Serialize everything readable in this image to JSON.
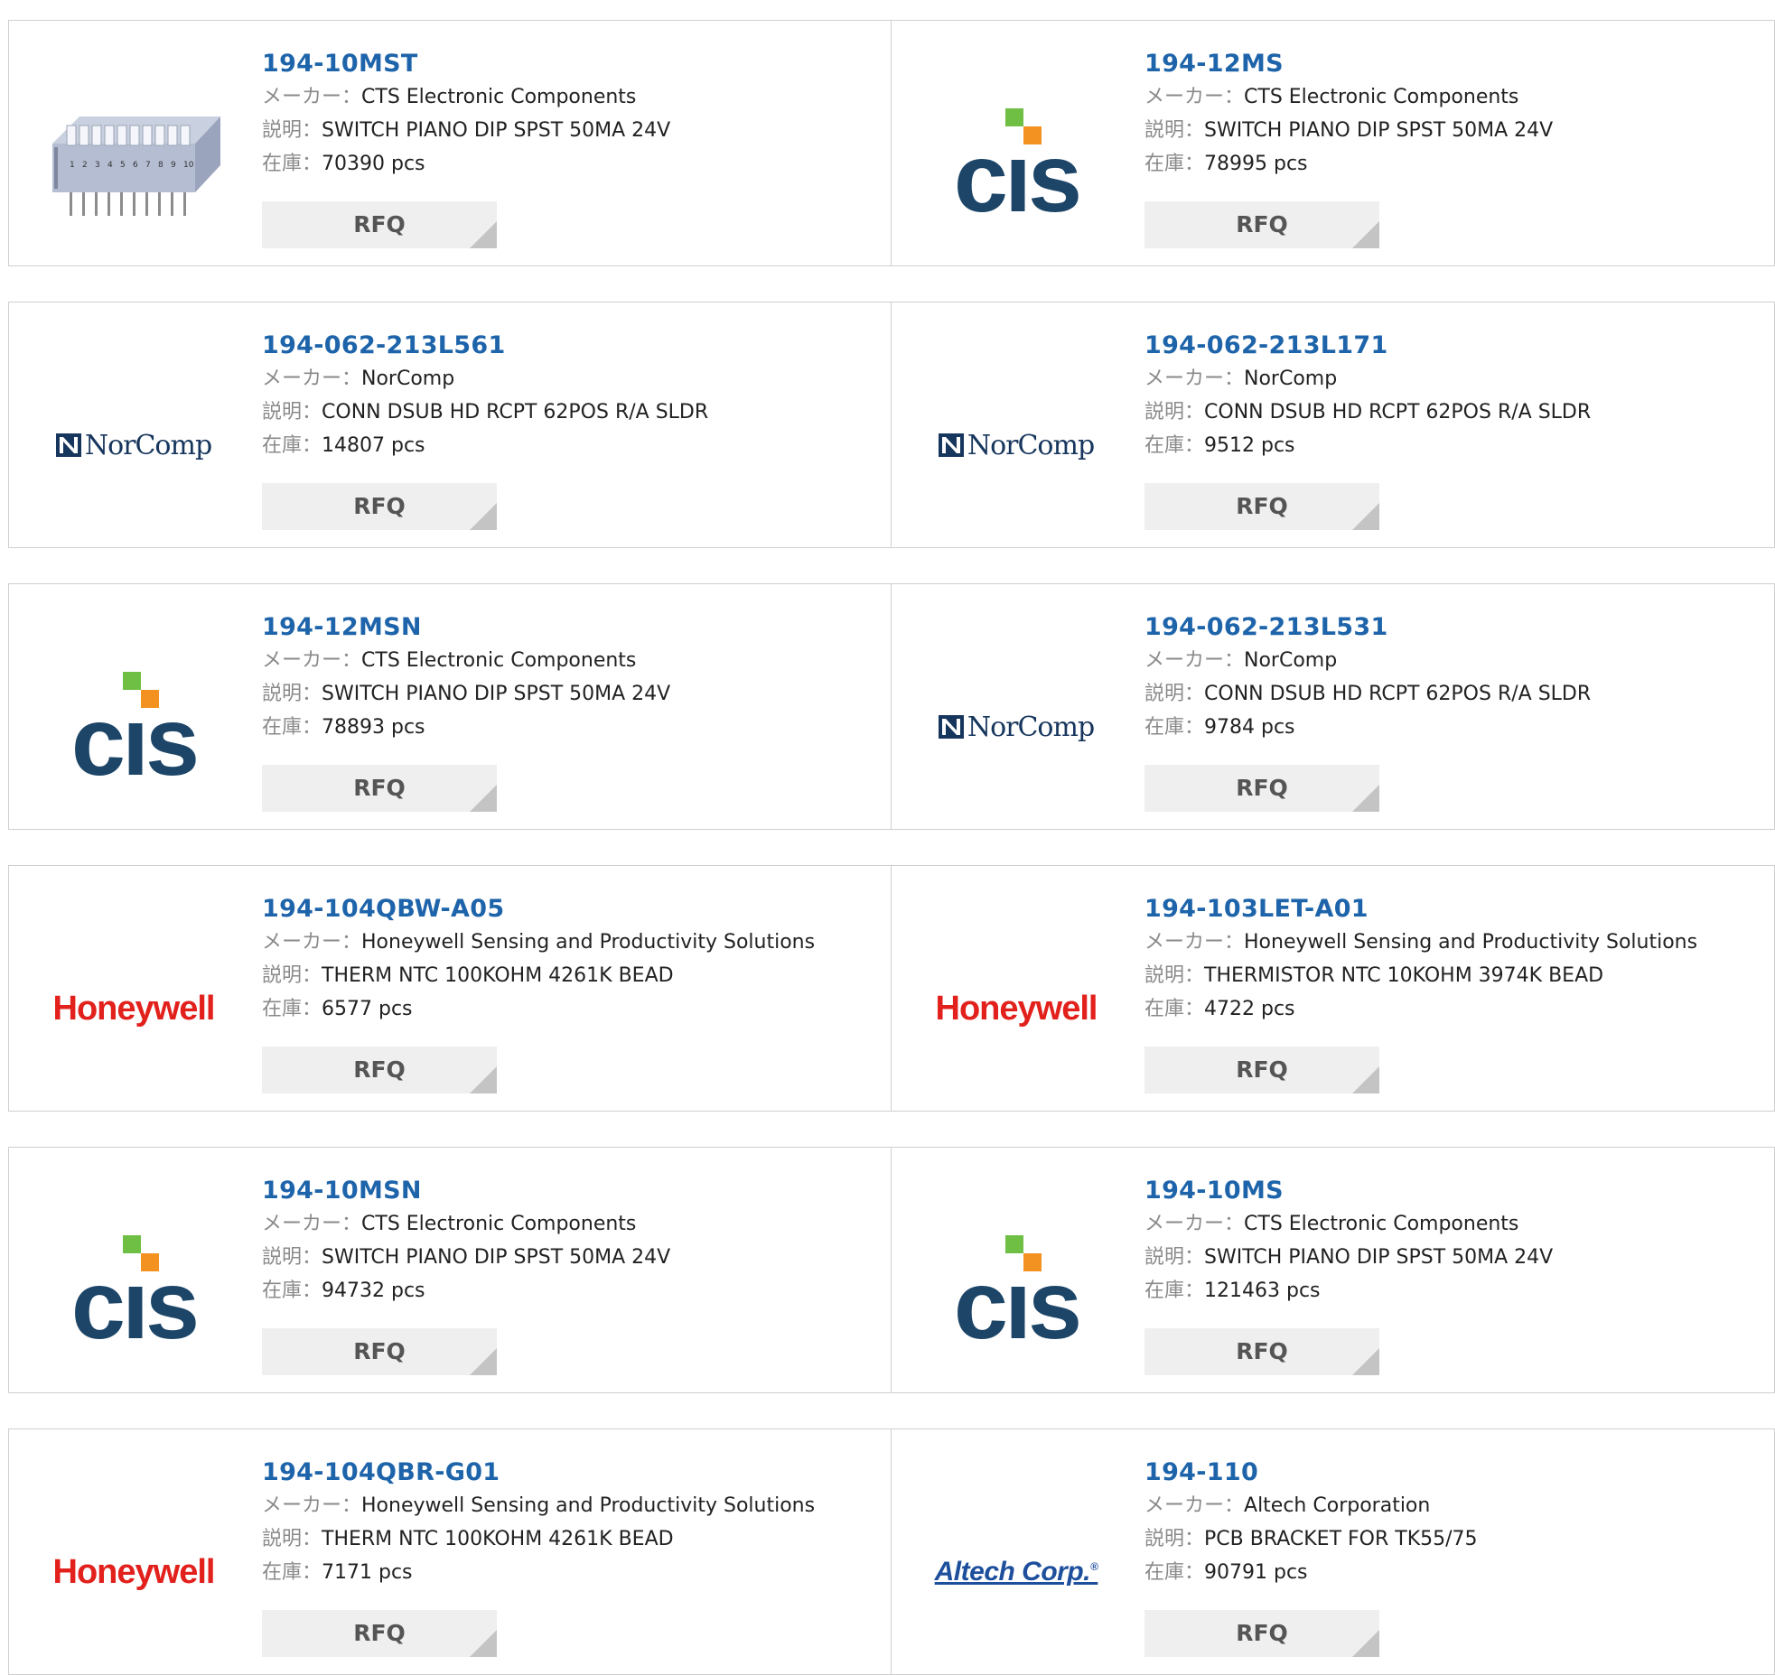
{
  "labels": {
    "manufacturer": "メーカー：",
    "description": "説明：",
    "stock": "在庫："
  },
  "brands": {
    "norcomp": "NorComp",
    "honeywell": "Honeywell",
    "altech": "Altech Corp.",
    "altech_mark": "®"
  },
  "products": [
    {
      "part": "194-10MST",
      "logo": "dip-switch-photo",
      "manufacturer": "CTS Electronic Components",
      "description": "SWITCH PIANO DIP SPST 50MA 24V",
      "stock": "70390 pcs",
      "rfq": "RFQ"
    },
    {
      "part": "194-12MS",
      "logo": "cts-logo",
      "manufacturer": "CTS Electronic Components",
      "description": "SWITCH PIANO DIP SPST 50MA 24V",
      "stock": "78995 pcs",
      "rfq": "RFQ"
    },
    {
      "part": "194-062-213L561",
      "logo": "norcomp-logo",
      "manufacturer": "NorComp",
      "description": "CONN DSUB HD RCPT 62POS R/A SLDR",
      "stock": "14807 pcs",
      "rfq": "RFQ"
    },
    {
      "part": "194-062-213L171",
      "logo": "norcomp-logo",
      "manufacturer": "NorComp",
      "description": "CONN DSUB HD RCPT 62POS R/A SLDR",
      "stock": "9512 pcs",
      "rfq": "RFQ"
    },
    {
      "part": "194-12MSN",
      "logo": "cts-logo",
      "manufacturer": "CTS Electronic Components",
      "description": "SWITCH PIANO DIP SPST 50MA 24V",
      "stock": "78893 pcs",
      "rfq": "RFQ"
    },
    {
      "part": "194-062-213L531",
      "logo": "norcomp-logo",
      "manufacturer": "NorComp",
      "description": "CONN DSUB HD RCPT 62POS R/A SLDR",
      "stock": "9784 pcs",
      "rfq": "RFQ"
    },
    {
      "part": "194-104QBW-A05",
      "logo": "honeywell-logo",
      "manufacturer": "Honeywell Sensing and Productivity Solutions",
      "description": "THERM NTC 100KOHM 4261K BEAD",
      "stock": "6577 pcs",
      "rfq": "RFQ"
    },
    {
      "part": "194-103LET-A01",
      "logo": "honeywell-logo",
      "manufacturer": "Honeywell Sensing and Productivity Solutions",
      "description": "THERMISTOR NTC 10KOHM 3974K BEAD",
      "stock": "4722 pcs",
      "rfq": "RFQ"
    },
    {
      "part": "194-10MSN",
      "logo": "cts-logo",
      "manufacturer": "CTS Electronic Components",
      "description": "SWITCH PIANO DIP SPST 50MA 24V",
      "stock": "94732 pcs",
      "rfq": "RFQ"
    },
    {
      "part": "194-10MS",
      "logo": "cts-logo",
      "manufacturer": "CTS Electronic Components",
      "description": "SWITCH PIANO DIP SPST 50MA 24V",
      "stock": "121463 pcs",
      "rfq": "RFQ"
    },
    {
      "part": "194-104QBR-G01",
      "logo": "honeywell-logo",
      "manufacturer": "Honeywell Sensing and Productivity Solutions",
      "description": "THERM NTC 100KOHM 4261K BEAD",
      "stock": "7171 pcs",
      "rfq": "RFQ"
    },
    {
      "part": "194-110",
      "logo": "altech-logo",
      "manufacturer": "Altech Corporation",
      "description": "PCB BRACKET FOR TK55/75",
      "stock": "90791 pcs",
      "rfq": "RFQ"
    }
  ],
  "colors": {
    "part_link": "#1e64aa",
    "label": "#8a8a8a",
    "cts_blue": "#1c4568",
    "cts_green": "#6fbf44",
    "cts_orange": "#f39221",
    "honeywell_red": "#e2211c",
    "norcomp_navy": "#17365d",
    "altech_blue": "#1d4f9c"
  }
}
